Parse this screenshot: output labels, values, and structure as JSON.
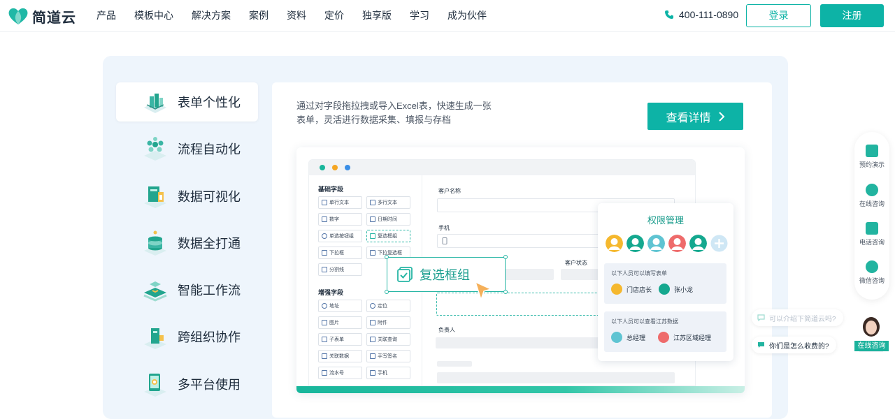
{
  "brand": {
    "name": "简道云",
    "accent": "#0db3a6"
  },
  "nav": {
    "items": [
      "产品",
      "模板中心",
      "解决方案",
      "案例",
      "资料",
      "定价",
      "独享版",
      "学习",
      "成为伙伴"
    ],
    "phone": "400-111-0890",
    "login": "登录",
    "signup": "注册"
  },
  "tabs": [
    {
      "label": "表单个性化",
      "icon": "form-icon",
      "active": true
    },
    {
      "label": "流程自动化",
      "icon": "workflow-icon",
      "active": false
    },
    {
      "label": "数据可视化",
      "icon": "chart-icon",
      "active": false
    },
    {
      "label": "数据全打通",
      "icon": "database-icon",
      "active": false
    },
    {
      "label": "智能工作流",
      "icon": "smart-flow-icon",
      "active": false
    },
    {
      "label": "跨组织协作",
      "icon": "collaboration-icon",
      "active": false
    },
    {
      "label": "多平台使用",
      "icon": "multi-platform-icon",
      "active": false
    }
  ],
  "content": {
    "description": "通过对字段拖拉拽或导入Excel表，快速生成一张表单，灵活进行数据采集、填报与存档",
    "detail_button": "查看详情"
  },
  "builder": {
    "basic_title": "基础字段",
    "basic_fields": [
      "单行文本",
      "多行文本",
      "数字",
      "日期时间",
      "单选按钮组",
      "复选框组",
      "下拉框",
      "下拉复选框",
      "分割线"
    ],
    "advanced_title": "增强字段",
    "advanced_fields": [
      "地址",
      "定位",
      "图片",
      "附件",
      "子表单",
      "关联查询",
      "关联数据",
      "手写签名",
      "流水号",
      "手机"
    ],
    "labels": {
      "customer_name": "客户名称",
      "phone": "手机",
      "customer_status": "客户状态",
      "owner": "负责人"
    },
    "drag_label": "复选框组"
  },
  "permission": {
    "title": "权限管理",
    "avatar_colors": [
      "#f5b82e",
      "#15a88f",
      "#5fc4d2",
      "#ee6b6b",
      "#15a88f"
    ],
    "group1": {
      "caption": "以下人员可以填写表单",
      "people": [
        "门店店长",
        "张小龙"
      ]
    },
    "group2": {
      "caption": "以下人员可以查看江苏数据",
      "people": [
        "总经理",
        "江苏区域经理"
      ]
    }
  },
  "float_bar": {
    "items": [
      {
        "label": "预约演示",
        "icon": "demo-icon"
      },
      {
        "label": "在线咨询",
        "icon": "chat-icon"
      },
      {
        "label": "电话咨询",
        "icon": "phone-icon"
      },
      {
        "label": "微信咨询",
        "icon": "wechat-icon"
      }
    ]
  },
  "chat_prompts": [
    "可以介绍下简道云吗?",
    "你们是怎么收费的?"
  ],
  "agent_label": "在线咨询"
}
